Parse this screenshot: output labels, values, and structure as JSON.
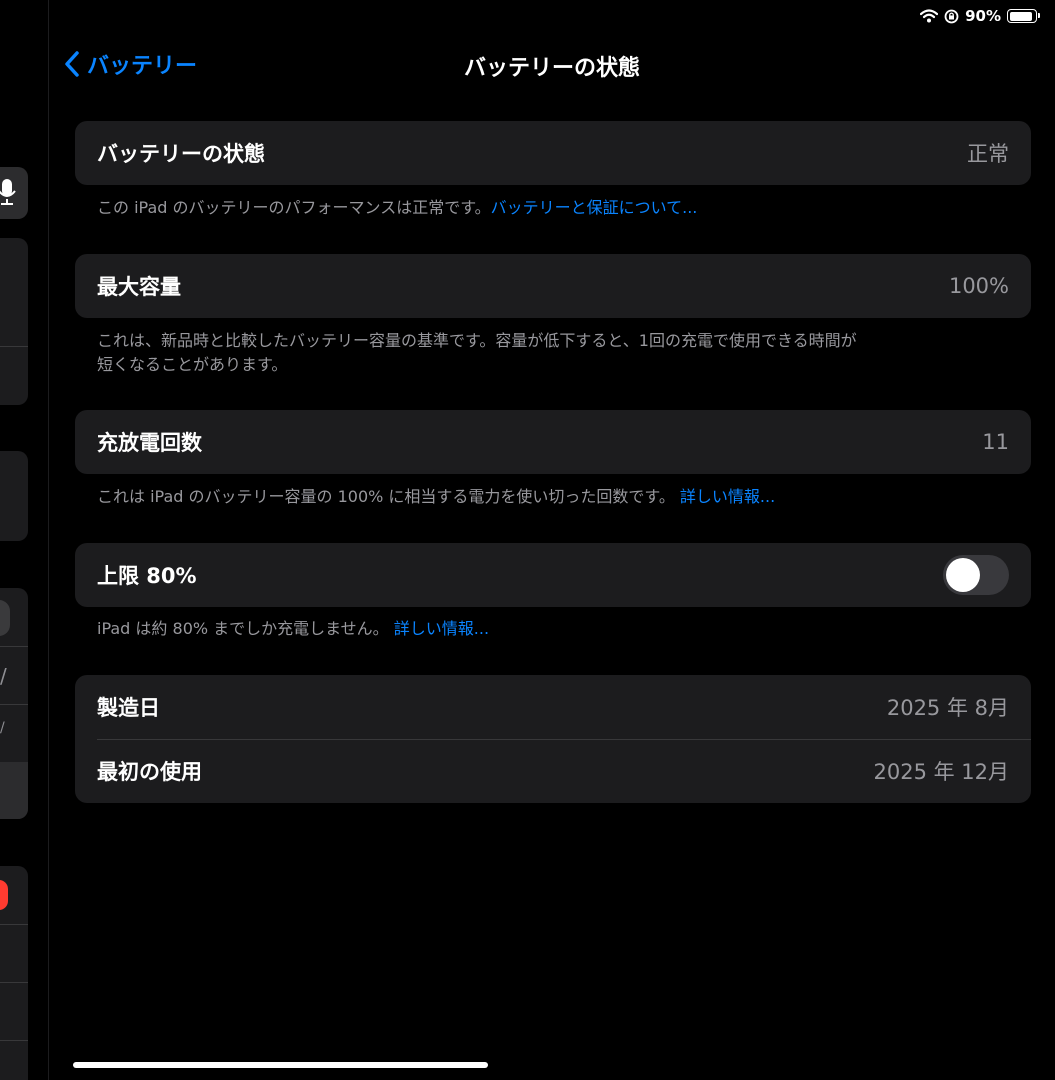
{
  "status_bar": {
    "battery_percent": "90%",
    "battery_level": 0.9
  },
  "nav": {
    "back_label": "バッテリー",
    "title": "バッテリーの状態"
  },
  "health": {
    "label": "バッテリーの状態",
    "value": "正常",
    "footnote": "この iPad のバッテリーのパフォーマンスは正常です。",
    "link": "バッテリーと保証について..."
  },
  "capacity": {
    "label": "最大容量",
    "value": "100%",
    "footnote_line1": "これは、新品時と比較したバッテリー容量の基準です。容量が低下すると、1回の充電で使用できる時間が",
    "footnote_line2": "短くなることがあります。"
  },
  "cycles": {
    "label": "充放電回数",
    "value": "11",
    "footnote": "これは iPad のバッテリー容量の 100% に相当する電力を使い切った回数です。",
    "link": "詳しい情報..."
  },
  "limit": {
    "label": "上限 80%",
    "enabled": false,
    "footnote": "iPad は約 80% までしか充電しません。",
    "link": "詳しい情報..."
  },
  "dates": {
    "manufacture_label": "製造日",
    "manufacture_value": "2025 年 8月",
    "first_use_label": "最初の使用",
    "first_use_value": "2025 年 12月"
  }
}
